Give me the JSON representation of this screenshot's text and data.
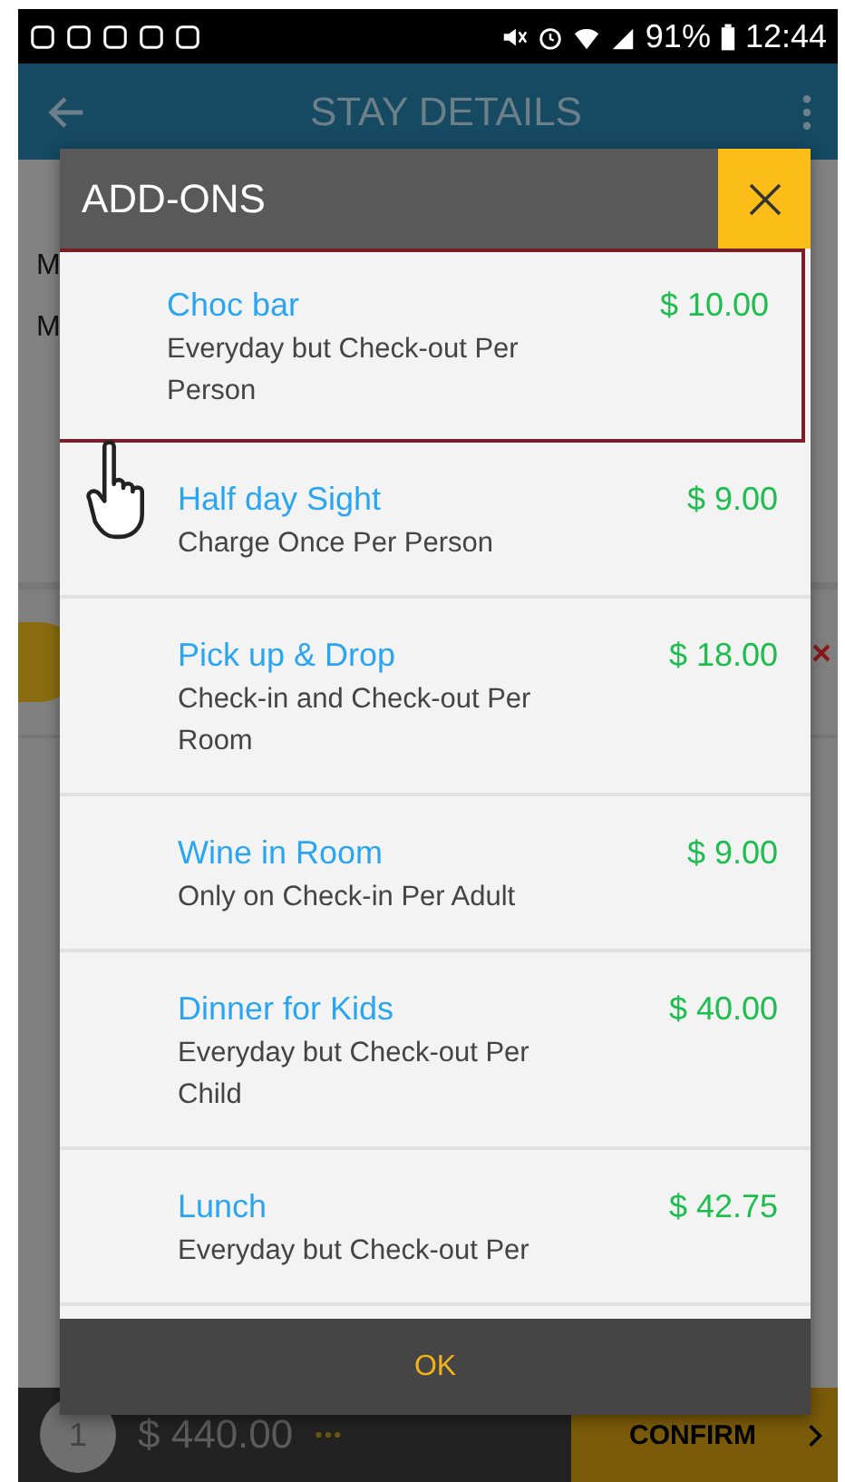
{
  "status_bar": {
    "battery": "91%",
    "time": "12:44"
  },
  "app_bar": {
    "title": "STAY DETAILS"
  },
  "background": {
    "partial_texts": [
      "M",
      "M"
    ]
  },
  "dialog": {
    "title": "ADD-ONS",
    "items": [
      {
        "name": "Choc bar",
        "description": "Everyday but Check-out Per Person",
        "price": "$ 10.00",
        "selected": true
      },
      {
        "name": "Half day Sight",
        "description": "Charge Once Per Person",
        "price": "$ 9.00",
        "selected": false
      },
      {
        "name": "Pick up & Drop",
        "description": "Check-in and Check-out Per Room",
        "price": "$ 18.00",
        "selected": false
      },
      {
        "name": "Wine in Room",
        "description": "Only on Check-in Per Adult",
        "price": "$ 9.00",
        "selected": false
      },
      {
        "name": "Dinner for Kids",
        "description": "Everyday but Check-out Per Child",
        "price": "$ 40.00",
        "selected": false
      },
      {
        "name": "Lunch",
        "description": "Everyday but Check-out Per",
        "price": "$ 42.75",
        "selected": false
      }
    ],
    "ok": "OK"
  },
  "footer": {
    "count": "1",
    "total": "$ 440.00",
    "more": "•••",
    "confirm": "CONFIRM"
  }
}
